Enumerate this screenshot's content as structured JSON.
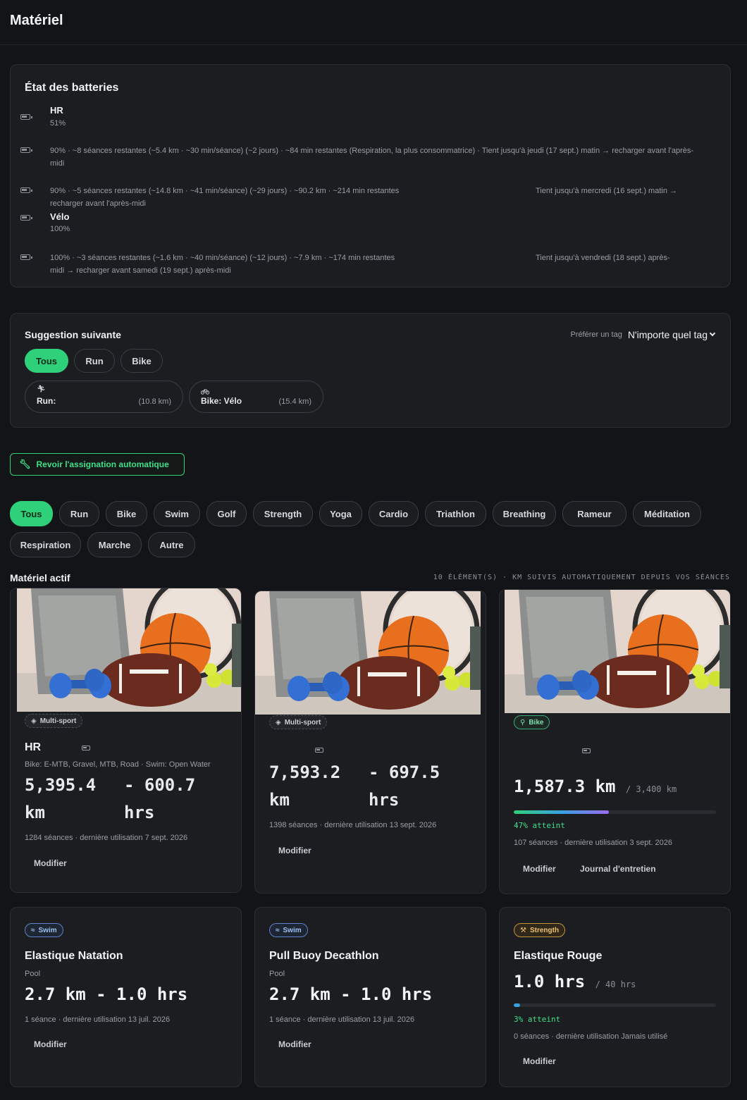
{
  "page": {
    "title": "Matériel"
  },
  "batteries": {
    "title": "État des batteries",
    "rows": [
      {
        "name": "HR",
        "pct": "51%"
      },
      {
        "text": "90% · ~8 séances restantes (~5.4 km · ~30 min/séance) (~2 jours) · ~84 min restantes (Respiration, la plus consommatrice) · Tient jusqu'à jeudi (17 sept.) matin → recharger avant l'après-midi"
      },
      {
        "text_left": "90% · ~5 séances restantes (~14.8 km · ~41 min/séance) (~29 jours) · ~90.2 km · ~214 min restantes",
        "text_right": "Tient jusqu'à mercredi (16 sept.) matin →",
        "text_cont": "recharger avant l'après-midi"
      },
      {
        "name": "Vélo",
        "pct": "100%"
      },
      {
        "text_left": "100% · ~3 séances restantes (~1.6 km · ~40 min/séance) (~12 jours) · ~7.9 km · ~174 min restantes",
        "text_right": "Tient jusqu'à vendredi (18 sept.) après-",
        "text_cont": "midi → recharger avant samedi (19 sept.) après-midi"
      }
    ]
  },
  "suggestion": {
    "title": "Suggestion suivante",
    "prefer_label": "Préférer un tag",
    "prefer_value": "N'importe quel tag",
    "filters": [
      "Tous",
      "Run",
      "Bike"
    ],
    "cards": [
      {
        "icon": "run-icon",
        "label": "Run:",
        "distance": "(10.8 km)"
      },
      {
        "icon": "bike-icon",
        "label": "Bike: Vélo",
        "distance": "(15.4 km)"
      }
    ]
  },
  "review_button": "Revoir l'assignation automatique",
  "categories_row1": [
    "Tous",
    "Run",
    "Bike",
    "Swim",
    "Golf",
    "Strength",
    "Yoga",
    "Cardio",
    "Triathlon",
    "Breathing",
    "Rameur",
    "Méditation"
  ],
  "categories_row2": [
    "Respiration",
    "Marche",
    "Autre"
  ],
  "active": {
    "title": "Matériel actif",
    "meta": "10 ÉLÉMENT(S) · KM SUIVIS AUTOMATIQUEMENT DEPUIS VOS SÉANCES"
  },
  "cards": [
    {
      "badge": "Multi-sport",
      "name": "HR",
      "sub": "Bike: E-MTB, Gravel, MTB, Road · Swim: Open Water",
      "dist_a": "5,395.4",
      "dist_b": "km",
      "time_a": "- 600.7",
      "time_b": "hrs",
      "meta": "1284 séances · dernière utilisation 7 sept. 2026",
      "edit": "Modifier"
    },
    {
      "badge": "Multi-sport",
      "dist_a": "7,593.2",
      "dist_b": "km",
      "time_a": "- 697.5",
      "time_b": "hrs",
      "meta": "1398 séances · dernière utilisation 13 sept. 2026",
      "edit": "Modifier"
    },
    {
      "badge": "Bike",
      "value": "1,587.3 km",
      "target": "/ 3,400 km",
      "progress": 0.47,
      "pct": "47% atteint",
      "meta": "107 séances · dernière utilisation 3 sept. 2026",
      "edit": "Modifier",
      "log": "Journal d'entretien"
    },
    {
      "badge": "Swim",
      "name": "Elastique Natation",
      "sub": "Pool",
      "value": "2.7 km - 1.0 hrs",
      "meta": "1 séance · dernière utilisation 13 juil. 2026",
      "edit": "Modifier"
    },
    {
      "badge": "Swim",
      "name": "Pull Buoy Decathlon",
      "sub": "Pool",
      "value": "2.7 km - 1.0 hrs",
      "meta": "1 séance · dernière utilisation 13 juil. 2026",
      "edit": "Modifier"
    },
    {
      "badge": "Strength",
      "name": "Elastique Rouge",
      "value": "1.0 hrs",
      "target": "/ 40 hrs",
      "progress": 0.03,
      "pct": "3% atteint",
      "meta": "0 séances · dernière utilisation Jamais utilisé",
      "edit": "Modifier"
    }
  ],
  "colors": {
    "accent": "#2fd07a",
    "background": "#131417",
    "card": "#1c1d21"
  }
}
